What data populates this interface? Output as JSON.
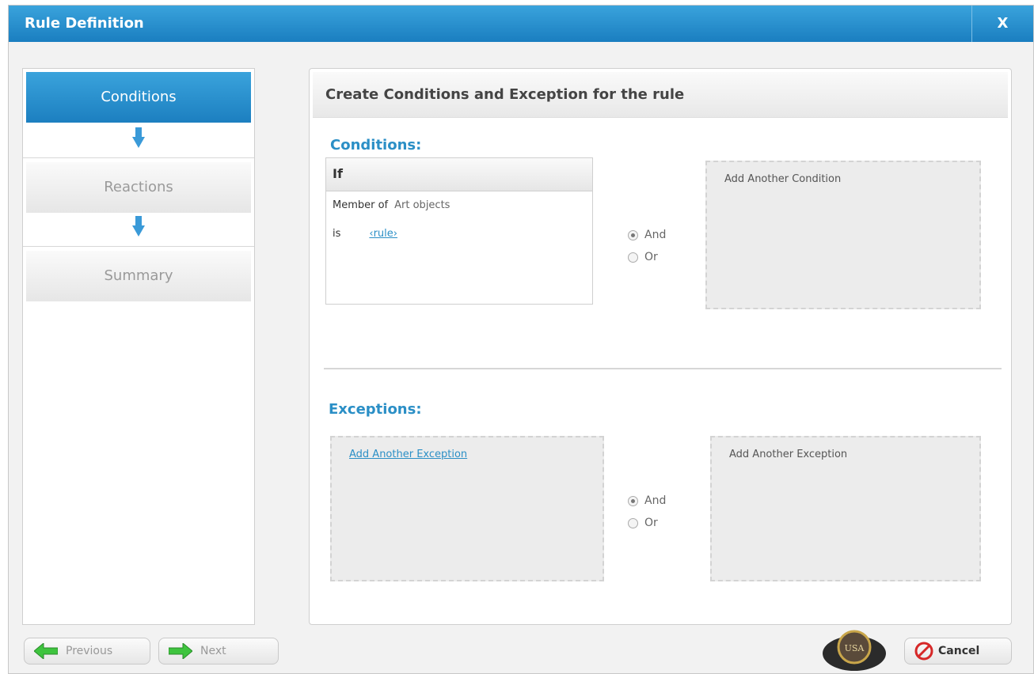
{
  "window": {
    "title": "Rule Definition",
    "close_label": "X"
  },
  "steps": [
    {
      "label": "Conditions",
      "active": true
    },
    {
      "label": "Reactions",
      "active": false
    },
    {
      "label": "Summary",
      "active": false
    }
  ],
  "main": {
    "header": "Create Conditions and Exception for the rule",
    "conditions": {
      "title": "Conditions:",
      "if_label": "If",
      "row1_label": "Member of",
      "row1_value": "Art objects",
      "row2_label": "is",
      "row2_link": "‹rule›",
      "logic": {
        "and_label": "And",
        "or_label": "Or",
        "selected": "And"
      },
      "add_another": "Add Another Condition"
    },
    "exceptions": {
      "title": "Exceptions:",
      "left_link": "Add Another Exception",
      "logic": {
        "and_label": "And",
        "or_label": "Or",
        "selected": "And"
      },
      "add_another": "Add Another Exception"
    }
  },
  "footer": {
    "previous_label": "Previous",
    "next_label": "Next",
    "cancel_label": "Cancel",
    "badge_text": "USA"
  },
  "colors": {
    "accent": "#1a7ec0",
    "link": "#2b8fc6",
    "next_green": "#3ec43e",
    "cancel_red": "#d62828"
  }
}
